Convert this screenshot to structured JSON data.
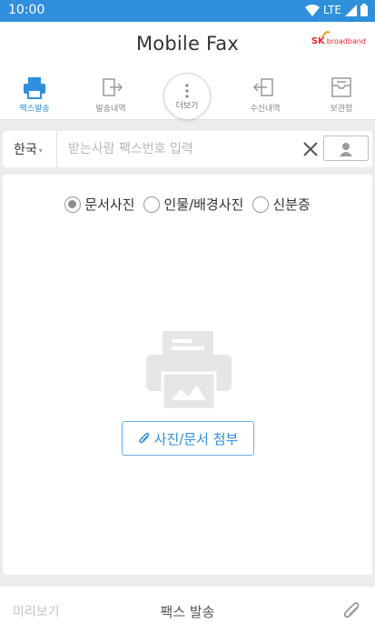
{
  "status_bar": {
    "time": "10:00",
    "network": "LTE",
    "color": "#2f8fdc"
  },
  "header": {
    "title": "Mobile Fax",
    "brand_logo": {
      "mark": "SK",
      "text": "broadband"
    }
  },
  "tabs": [
    {
      "label": "팩스발송",
      "icon": "printer-icon",
      "active": true
    },
    {
      "label": "발송내역",
      "icon": "outbox-icon",
      "active": false
    },
    {
      "label": "더보기",
      "icon": "more-vertical-icon",
      "active": false
    },
    {
      "label": "수신내역",
      "icon": "inbox-icon",
      "active": false
    },
    {
      "label": "보관함",
      "icon": "archive-icon",
      "active": false
    }
  ],
  "recipient": {
    "country": "한국",
    "fax_placeholder": "받는사람 팩스번호 입력",
    "fax_value": ""
  },
  "photo_type": {
    "selected": "문서사진",
    "options": [
      "문서사진",
      "인물/배경사진",
      "신분증"
    ]
  },
  "attach_button": {
    "label": "사진/문서 첨부",
    "icon": "paperclip-icon"
  },
  "bottom_bar": {
    "preview_label": "미리보기",
    "send_label": "팩스 발송",
    "attach_icon": "paperclip-icon"
  },
  "colors": {
    "accent": "#2f8fdc",
    "brand_red": "#e8262b"
  }
}
